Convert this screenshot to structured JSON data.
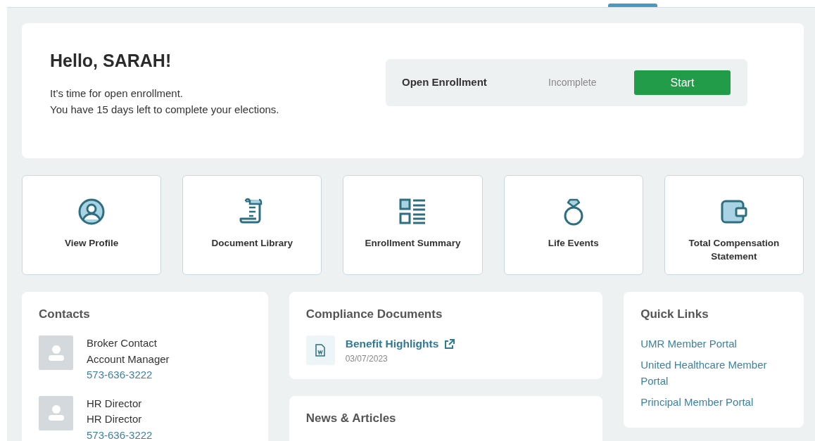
{
  "greeting": {
    "title": "Hello, SARAH!",
    "lines": [
      "It’s time for open enrollment.",
      "You have 15 days left to complete your elections."
    ]
  },
  "enrollment": {
    "label": "Open Enrollment",
    "status": "Incomplete",
    "button": "Start"
  },
  "tiles": [
    {
      "label": "View Profile"
    },
    {
      "label": "Document Library"
    },
    {
      "label": "Enrollment Summary"
    },
    {
      "label": "Life Events"
    },
    {
      "label": "Total Compensation Statement"
    }
  ],
  "contacts": {
    "title": "Contacts",
    "items": [
      {
        "name": "Broker Contact",
        "role": "Account Manager",
        "phone": "573-636-3222"
      },
      {
        "name": "HR Director",
        "role": "HR Director",
        "phone": "573-636-3222"
      }
    ]
  },
  "compliance": {
    "title": "Compliance Documents",
    "documents": [
      {
        "name": "Benefit Highlights",
        "date": "03/07/2023"
      }
    ]
  },
  "news": {
    "title": "News & Articles"
  },
  "quick_links": {
    "title": "Quick Links",
    "links": [
      "UMR Member Portal",
      "United Healthcare Member Portal",
      "Principal Member Portal"
    ]
  }
}
